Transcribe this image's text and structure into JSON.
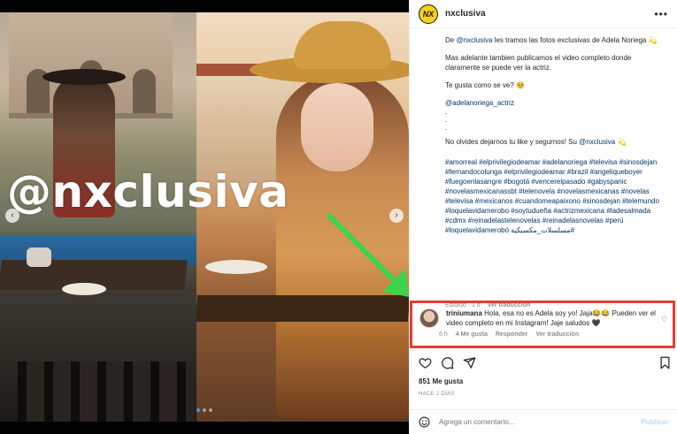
{
  "post": {
    "username": "nxclusiva",
    "avatar_text": "NX",
    "watermark": "@nxclusiva"
  },
  "caption": {
    "line1_prefix": "De ",
    "line1_mention": "@nxclusiva",
    "line1_suffix": " les tramos las fotos exclusivas de Adela Noriega 💫",
    "line2": "Mas adelante tambien publicamos el video completo donde claramente se puede ver la actriz.",
    "line3": "Te gusta como se ve? 🥺",
    "mention2": "@adelanoriega_actriz",
    "dots": [
      ".",
      ".",
      "."
    ],
    "line4_prefix": "No olvides dejarnos tu like y segurnos! Su ",
    "line4_mention": "@nxclusiva",
    "line4_suffix": " 💫",
    "hashtags": "#amorreal #elprivilegiodeamar #adelanoriega #televisa #sinosdejan #fernandocolunga #elprivilegiodeamar #brazil #angeliqueboyer #fuegoenlasangre #bogotá #vencerelpasado #gabyspanic #novelasmexicanassbt #telenovela #novelasmexicanas #novelas #televisa #mexicanos #cuandomeapaixono #sinosdejan #telemundo #loquelavidamerobo #soytudueña #actrizmexicana #ladesalmada #cdmx #reinadelastelenovelas #reinadelasnovelas #perú #loquelavidamerobó مسلسلات_مكسيكية#",
    "edited": "Editado · 1 d",
    "translate": "Ver traducción"
  },
  "comment": {
    "user": "triniumana",
    "text": " Hola, esa no es Adela soy yo! Jaja😂😂 Pueden ver el video completo en mi Instagram! Jaje saludos 🖤",
    "time": "6 h",
    "likes": "4 Me gusta",
    "reply": "Responder",
    "translate": "Ver traducción"
  },
  "footer": {
    "likes": "851 Me gusta",
    "time": "HACE 2 DÍAS",
    "comment_placeholder": "Agrega un comentario...",
    "publish": "Publicar"
  },
  "icons": {
    "more": "more-horizontal-icon",
    "like": "heart-icon",
    "comment": "comment-icon",
    "share": "share-icon",
    "save": "bookmark-icon",
    "emoji": "emoji-icon"
  },
  "colors": {
    "highlight_border": "#e63d33",
    "arrow": "#3dd34a",
    "link": "#00376b",
    "avatar_bg": "#f5d21a"
  },
  "carousel": {
    "dot_count": 3,
    "active_index": 0
  }
}
